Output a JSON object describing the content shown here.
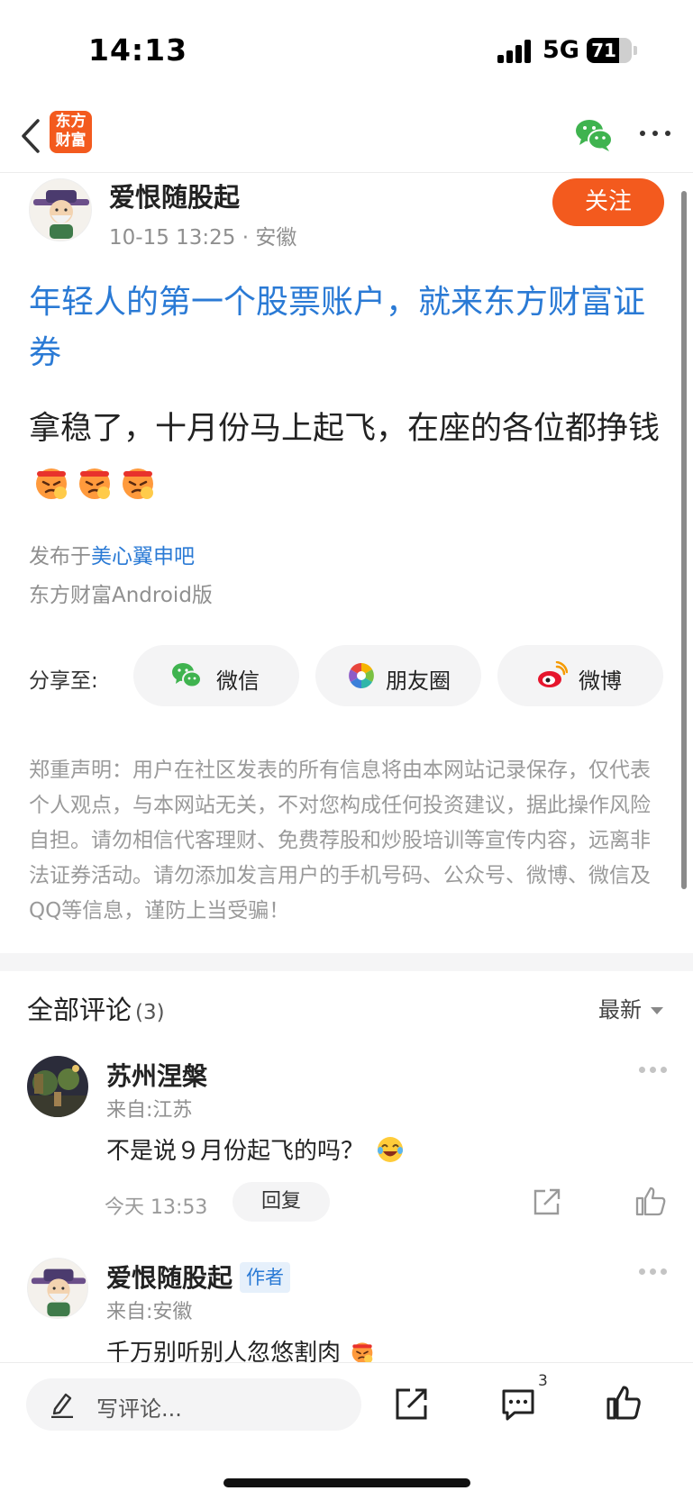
{
  "status_bar": {
    "time": "14:13",
    "network": "5G",
    "battery": "71",
    "battery_level": 0.71
  },
  "nav": {
    "logo_text": "东方\n财富"
  },
  "post": {
    "author_name": "爱恨随股起",
    "date": "10-15 13:25",
    "location": "安徽",
    "follow_label": "关注",
    "title": "年轻人的第一个股票账户，就来东方财富证券",
    "body": "拿稳了，十月份马上起飞，在座的各位都挣钱",
    "emoji_count": 3,
    "published_prefix": "发布于",
    "bar_name": "美心翼申吧",
    "client": "东方财富Android版"
  },
  "share": {
    "label": "分享至:",
    "options": [
      {
        "label": "微信",
        "icon": "wechat-icon"
      },
      {
        "label": "朋友圈",
        "icon": "moments-icon"
      },
      {
        "label": "微博",
        "icon": "weibo-icon"
      }
    ]
  },
  "disclaimer": "郑重声明：用户在社区发表的所有信息将由本网站记录保存，仅代表个人观点，与本网站无关，不对您构成任何投资建议，据此操作风险自担。请勿相信代客理财、免费荐股和炒股培训等宣传内容，远离非法证券活动。请勿添加发言用户的手机号码、公众号、微博、微信及QQ等信息，谨防上当受骗！",
  "comments": {
    "title": "全部评论",
    "count": "(3)",
    "sort_label": "最新",
    "items": [
      {
        "name": "苏州涅槃",
        "from": "来自:江苏",
        "text": "不是说９月份起飞的吗？",
        "time": "今天 13:53",
        "reply": "回复"
      },
      {
        "name": "爱恨随股起",
        "tag": "作者",
        "from": "来自:安徽",
        "text": "千万别听别人忽悠割肉"
      }
    ]
  },
  "bottom_bar": {
    "placeholder": "写评论...",
    "comment_count": "3"
  }
}
